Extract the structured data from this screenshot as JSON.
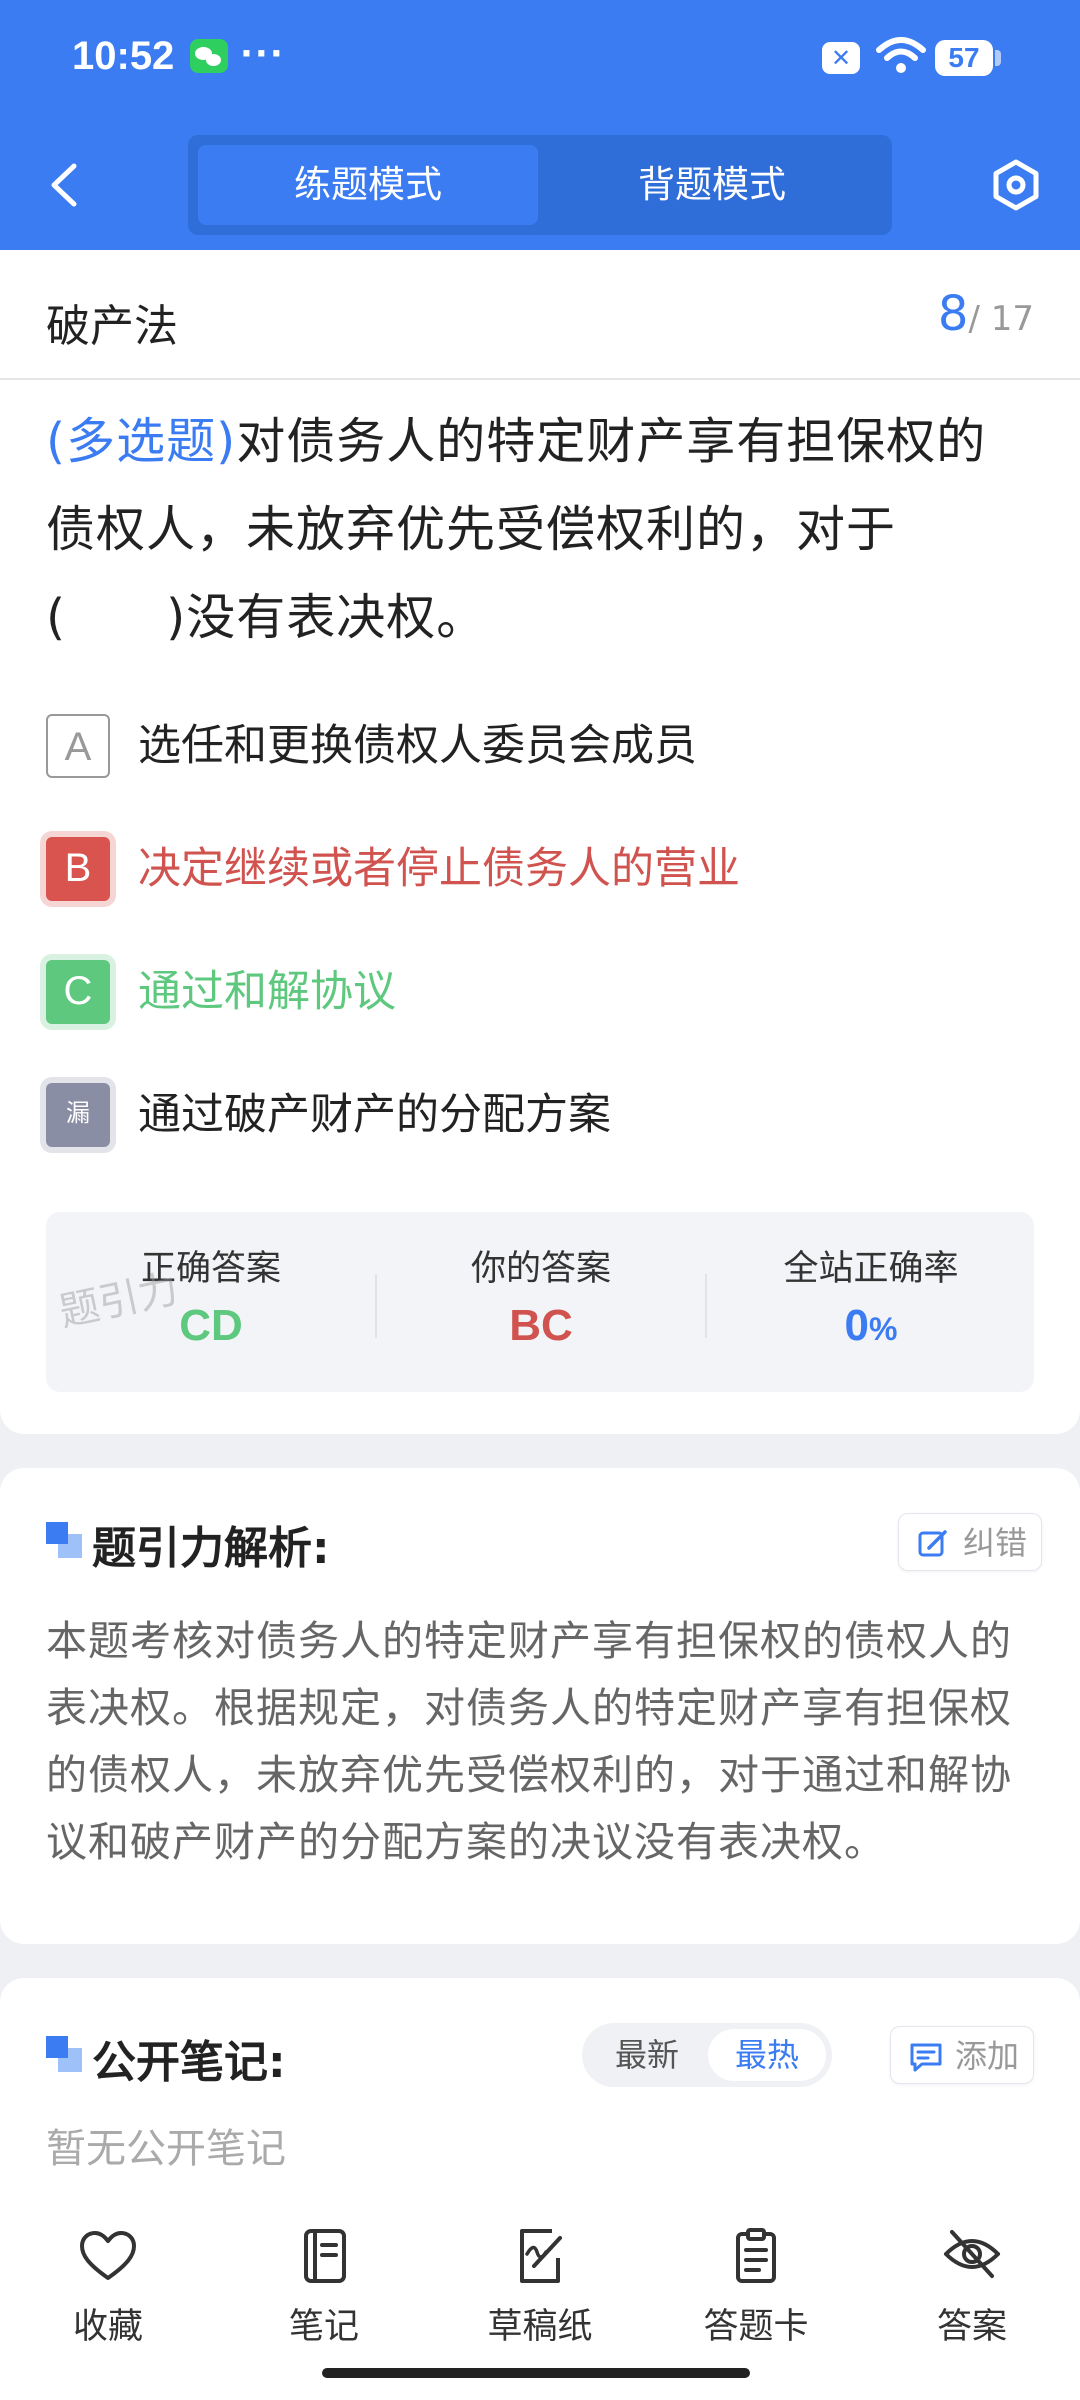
{
  "status_bar": {
    "time": "10:52",
    "more": "···",
    "battery": "57"
  },
  "header": {
    "tabs": [
      {
        "label": "练题模式",
        "active": true
      },
      {
        "label": "背题模式",
        "active": false
      }
    ]
  },
  "question": {
    "chapter": "破产法",
    "current": "8",
    "total": "/ 17",
    "type_label": "(多选题)",
    "text": "对债务人的特定财产享有担保权的债权人，未放弃优先受偿权利的，对于(　　)没有表决权。",
    "options": [
      {
        "key": "A",
        "text": "选任和更换债权人委员会成员",
        "state": "plain"
      },
      {
        "key": "B",
        "text": "决定继续或者停止债务人的营业",
        "state": "wrong"
      },
      {
        "key": "C",
        "text": "通过和解协议",
        "state": "correct"
      },
      {
        "key": "漏",
        "text": "通过破产财产的分配方案",
        "state": "missed"
      }
    ]
  },
  "answer_summary": {
    "correct_label": "正确答案",
    "correct_value": "CD",
    "yours_label": "你的答案",
    "yours_value": "BC",
    "rate_label": "全站正确率",
    "rate_value": "0",
    "rate_unit": "%",
    "watermark": "题引力"
  },
  "analysis": {
    "title": "题引力解析:",
    "correction_label": "纠错",
    "text": "本题考核对债务人的特定财产享有担保权的债权人的表决权。根据规定，对债务人的特定财产享有担保权的债权人，未放弃优先受偿权利的，对于通过和解协议和破产财产的分配方案的决议没有表决权。"
  },
  "notes": {
    "title": "公开笔记:",
    "sort_options": [
      "最新",
      "最热"
    ],
    "sort_selected": "最热",
    "add_label": "添加",
    "empty_text": "暂无公开笔记"
  },
  "bottom_nav": [
    {
      "label": "收藏",
      "icon": "heart-icon"
    },
    {
      "label": "笔记",
      "icon": "notebook-icon"
    },
    {
      "label": "草稿纸",
      "icon": "draft-icon"
    },
    {
      "label": "答题卡",
      "icon": "clipboard-icon"
    },
    {
      "label": "答案",
      "icon": "eye-off-icon"
    }
  ],
  "colors": {
    "brand": "#3b7cf2",
    "correct": "#5dc87e",
    "wrong": "#d0534f",
    "missed": "#8a8ea4"
  }
}
